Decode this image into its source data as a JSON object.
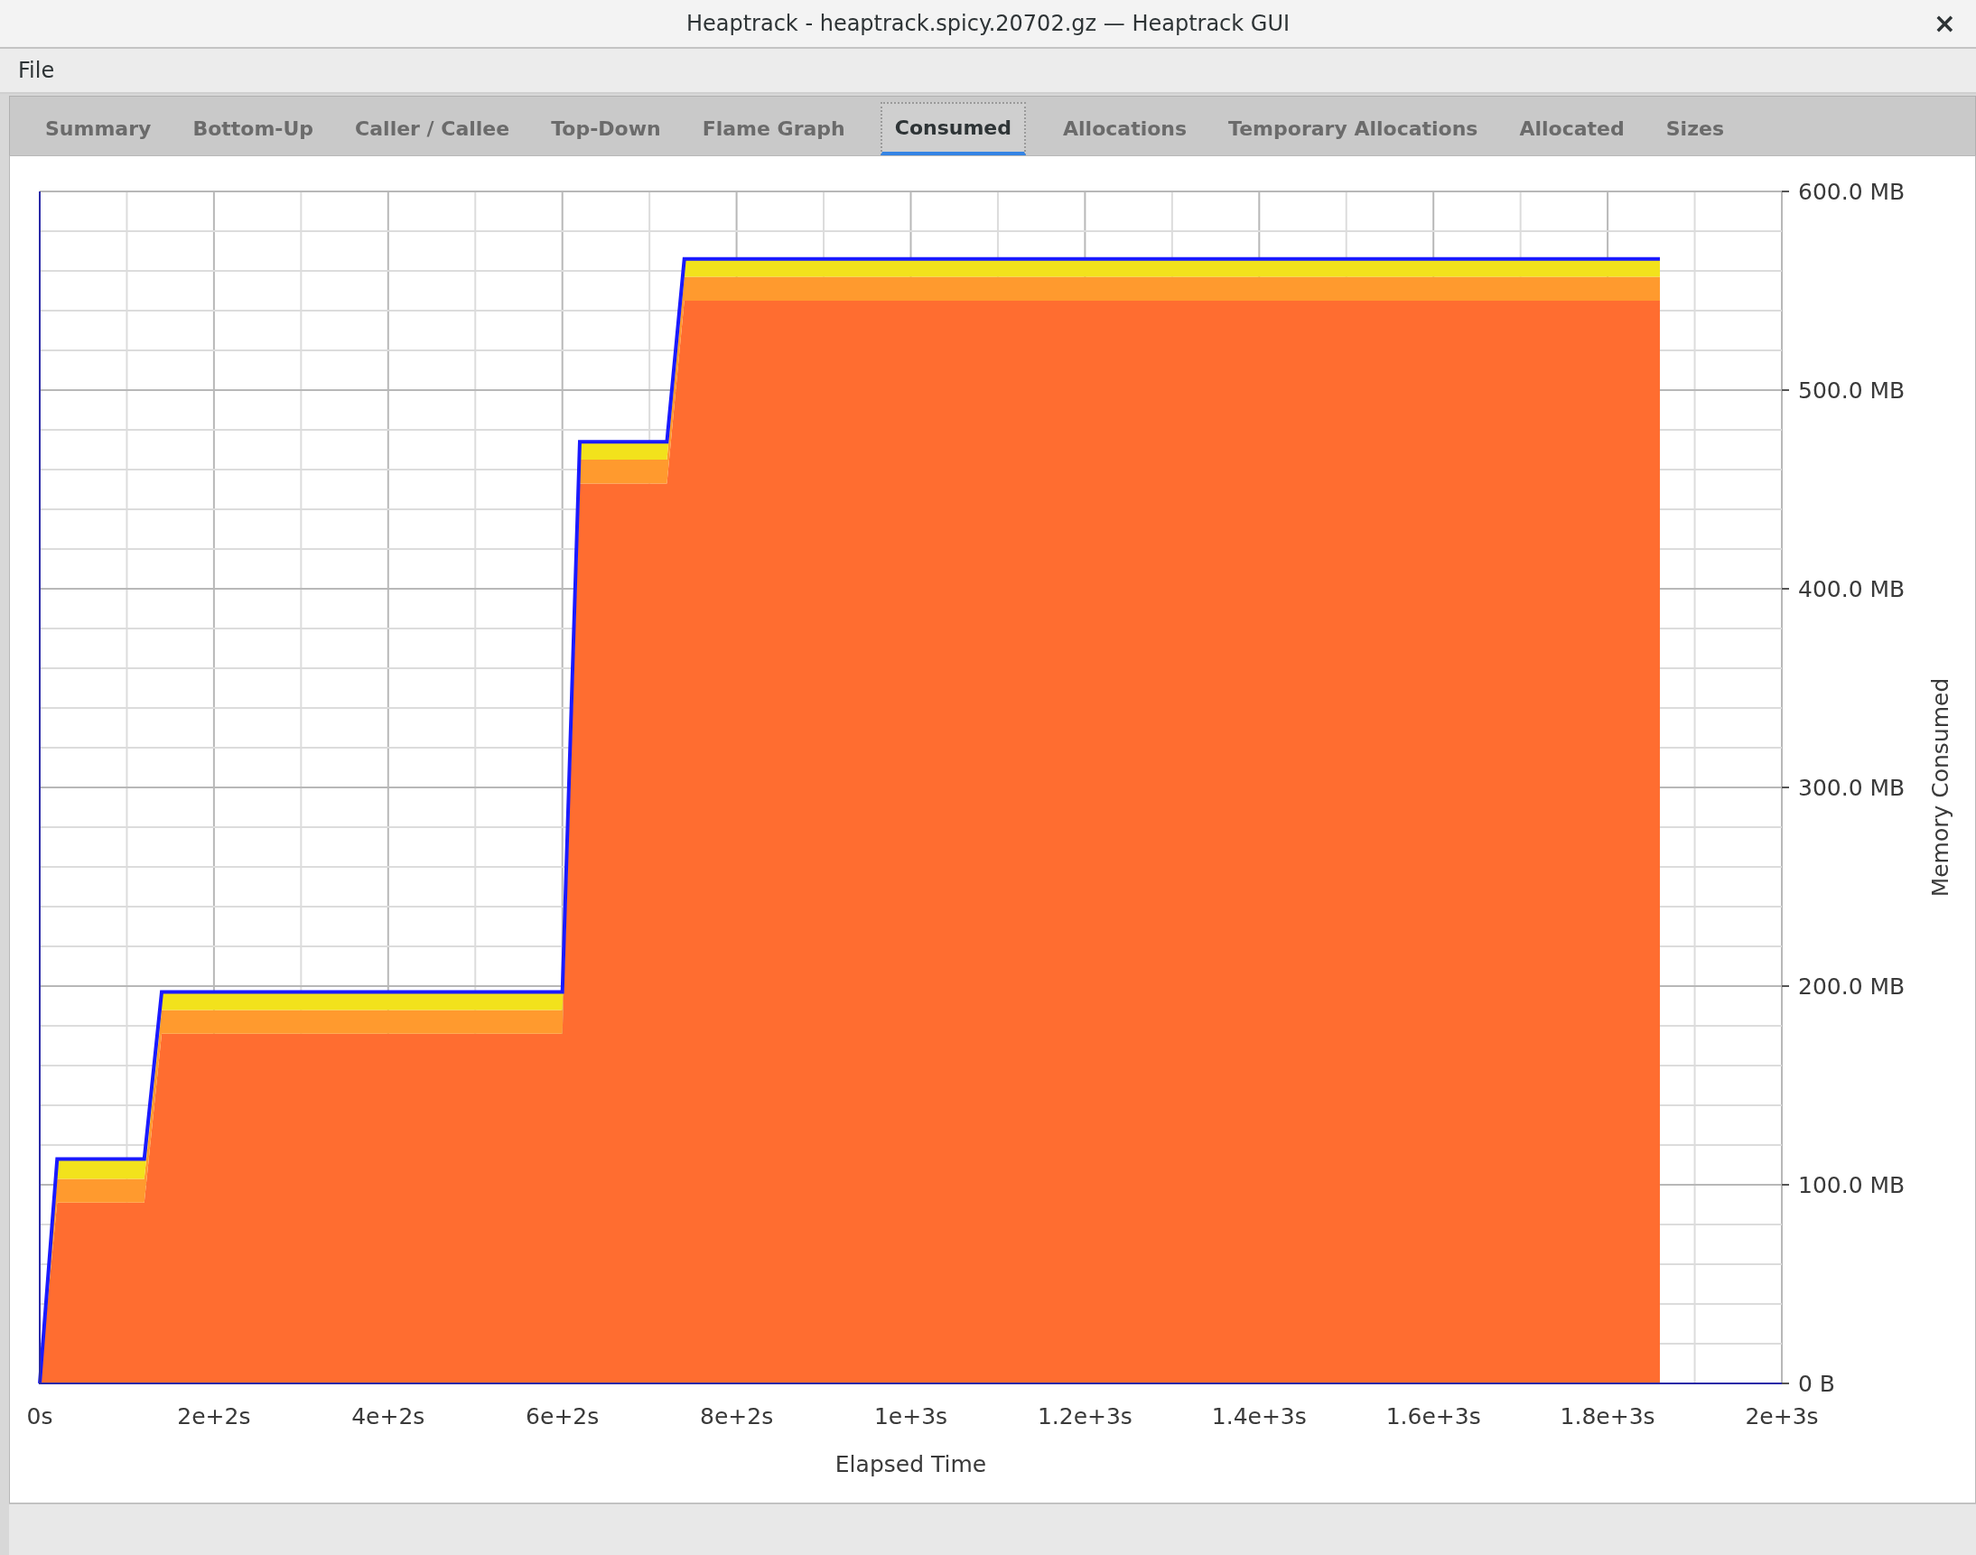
{
  "window": {
    "title": "Heaptrack - heaptrack.spicy.20702.gz — Heaptrack GUI",
    "close": "×"
  },
  "menu": [
    {
      "label": "File"
    }
  ],
  "tabs": [
    {
      "label": "Summary",
      "selected": false
    },
    {
      "label": "Bottom-Up",
      "selected": false
    },
    {
      "label": "Caller / Callee",
      "selected": false
    },
    {
      "label": "Top-Down",
      "selected": false
    },
    {
      "label": "Flame Graph",
      "selected": false
    },
    {
      "label": "Consumed",
      "selected": true
    },
    {
      "label": "Allocations",
      "selected": false
    },
    {
      "label": "Temporary Allocations",
      "selected": false
    },
    {
      "label": "Allocated",
      "selected": false
    },
    {
      "label": "Sizes",
      "selected": false
    }
  ],
  "consumed_chart": {
    "chart_data": {
      "type": "area",
      "stacked": true,
      "grid": true,
      "xlabel": "Elapsed Time",
      "ylabel": "Memory Consumed",
      "categories": [
        "0s",
        null,
        null,
        null,
        null,
        null,
        null,
        null,
        null,
        null,
        "2e+2s",
        null,
        null,
        null,
        null,
        null,
        null,
        null,
        null,
        null,
        "4e+2s",
        null,
        null,
        null,
        null,
        null,
        null,
        null,
        null,
        null,
        "6e+2s",
        null,
        null,
        null,
        null,
        null,
        null,
        null,
        null,
        null,
        "8e+2s",
        null,
        null,
        null,
        null,
        null,
        null,
        null,
        null,
        null,
        "1e+3s",
        null,
        null,
        null,
        null,
        null,
        null,
        null,
        null,
        null,
        "1.2e+3s",
        null,
        null,
        null,
        null,
        null,
        null,
        null,
        null,
        null,
        "1.4e+3s",
        null,
        null,
        null,
        null,
        null,
        null,
        null,
        null,
        null,
        "1.6e+3s",
        null,
        null,
        null,
        null,
        null,
        null,
        null,
        null,
        null,
        "1.8e+3s",
        null,
        null,
        null,
        null,
        null,
        null,
        null,
        null,
        null,
        "2e+3s"
      ],
      "series": [
        {
          "color": "#ff6d30",
          "values": [
            0,
            91,
            91,
            91,
            91,
            91,
            91,
            176,
            176,
            176,
            176,
            176,
            176,
            176,
            176,
            176,
            176,
            176,
            176,
            176,
            176,
            176,
            176,
            176,
            176,
            176,
            176,
            176,
            176,
            176,
            176,
            453,
            453,
            453,
            453,
            453,
            453,
            545,
            545,
            545,
            545,
            545,
            545,
            545,
            545,
            545,
            545,
            545,
            545,
            545,
            545,
            545,
            545,
            545,
            545,
            545,
            545,
            545,
            545,
            545,
            545,
            545,
            545,
            545,
            545,
            545,
            545,
            545,
            545,
            545,
            545,
            545,
            545,
            545,
            545,
            545,
            545,
            545,
            545,
            545,
            545,
            545,
            545,
            545,
            545,
            545,
            545,
            545,
            545,
            545,
            545,
            545,
            545,
            545,
            null,
            null,
            null,
            null,
            null,
            null,
            null
          ]
        },
        {
          "color": "#ff9a2e",
          "values": [
            0,
            12,
            12,
            12,
            12,
            12,
            12,
            12,
            12,
            12,
            12,
            12,
            12,
            12,
            12,
            12,
            12,
            12,
            12,
            12,
            12,
            12,
            12,
            12,
            12,
            12,
            12,
            12,
            12,
            12,
            12,
            12,
            12,
            12,
            12,
            12,
            12,
            12,
            12,
            12,
            12,
            12,
            12,
            12,
            12,
            12,
            12,
            12,
            12,
            12,
            12,
            12,
            12,
            12,
            12,
            12,
            12,
            12,
            12,
            12,
            12,
            12,
            12,
            12,
            12,
            12,
            12,
            12,
            12,
            12,
            12,
            12,
            12,
            12,
            12,
            12,
            12,
            12,
            12,
            12,
            12,
            12,
            12,
            12,
            12,
            12,
            12,
            12,
            12,
            12,
            12,
            12,
            12,
            12,
            null,
            null,
            null,
            null,
            null,
            null,
            null
          ]
        },
        {
          "color": "#f2e21c",
          "values": [
            0,
            10,
            10,
            10,
            10,
            10,
            10,
            9,
            9,
            9,
            9,
            9,
            9,
            9,
            9,
            9,
            9,
            9,
            9,
            9,
            9,
            9,
            9,
            9,
            9,
            9,
            9,
            9,
            9,
            9,
            9,
            9,
            9,
            9,
            9,
            9,
            9,
            9,
            9,
            9,
            9,
            9,
            9,
            9,
            9,
            9,
            9,
            9,
            9,
            9,
            9,
            9,
            9,
            9,
            9,
            9,
            9,
            9,
            9,
            9,
            9,
            9,
            9,
            9,
            9,
            9,
            9,
            9,
            9,
            9,
            9,
            9,
            9,
            9,
            9,
            9,
            9,
            9,
            9,
            9,
            9,
            9,
            9,
            9,
            9,
            9,
            9,
            9,
            9,
            9,
            9,
            9,
            9,
            9,
            null,
            null,
            null,
            null,
            null,
            null,
            null
          ]
        }
      ],
      "ylim": [
        0,
        600
      ],
      "yticks": [
        {
          "value": 0,
          "label": "0 B"
        },
        {
          "value": 100,
          "label": "100.0 MB"
        },
        {
          "value": 200,
          "label": "200.0 MB"
        },
        {
          "value": 300,
          "label": "300.0 MB"
        },
        {
          "value": 400,
          "label": "400.0 MB"
        },
        {
          "value": 500,
          "label": "500.0 MB"
        },
        {
          "value": 600,
          "label": "600.0 MB"
        }
      ]
    }
  }
}
